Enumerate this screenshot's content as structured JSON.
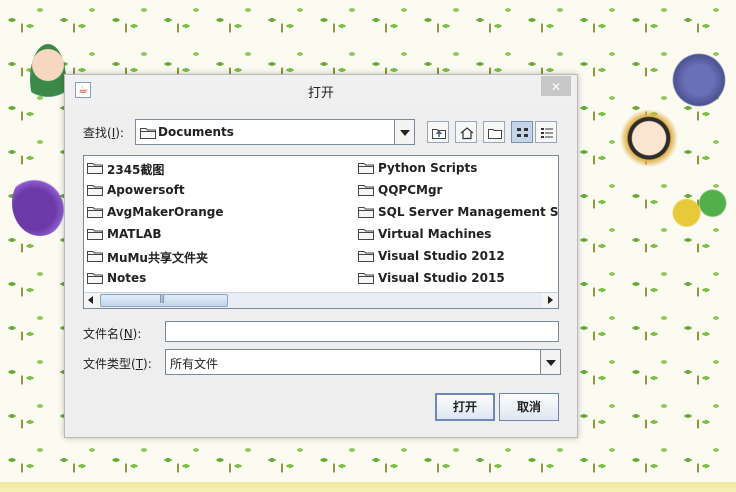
{
  "dialog": {
    "title": "打开",
    "look_in": {
      "label_prefix": "查找(",
      "mnemonic": "I",
      "label_suffix": "):",
      "value": "Documents"
    },
    "toolbar": {
      "up_icon": "up-one-level-icon",
      "home_icon": "home-icon",
      "new_folder_icon": "new-folder-icon",
      "list_view_icon": "list-view-icon",
      "details_view_icon": "details-view-icon"
    },
    "files": {
      "column1": [
        "2345截图",
        "Apowersoft",
        "AvgMakerOrange",
        "MATLAB",
        "MuMu共享文件夹",
        "Notes"
      ],
      "column2": [
        "Python Scripts",
        "QQPCMgr",
        "SQL Server Management Studio",
        "Virtual Machines",
        "Visual Studio 2012",
        "Visual Studio 2015"
      ]
    },
    "file_name": {
      "label_prefix": "文件名(",
      "mnemonic": "N",
      "label_suffix": "):",
      "value": ""
    },
    "file_type": {
      "label_prefix": "文件类型(",
      "mnemonic": "T",
      "label_suffix": "):",
      "value": "所有文件"
    },
    "buttons": {
      "open": "打开",
      "cancel": "取消"
    }
  }
}
